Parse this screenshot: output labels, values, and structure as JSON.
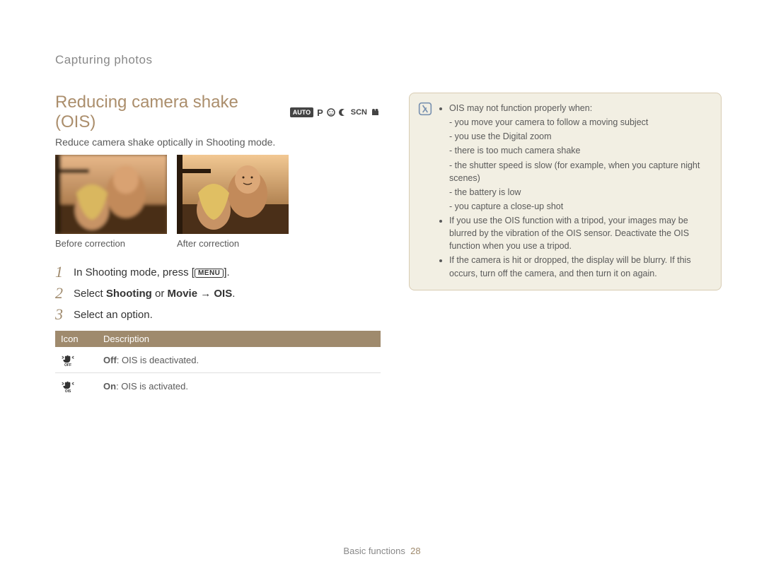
{
  "chapter": "Capturing photos",
  "heading": "Reducing camera shake (OIS)",
  "mode_icons": {
    "auto": "AUTO",
    "p": "P",
    "scn": "SCN"
  },
  "subhead": "Reduce camera shake optically in Shooting mode.",
  "before_caption": "Before correction",
  "after_caption": "After correction",
  "steps": [
    {
      "num": "1",
      "prefix": "In Shooting mode, press [",
      "btn": "MENU",
      "suffix": "]."
    },
    {
      "num": "2",
      "text_a": "Select ",
      "bold_a": "Shooting",
      "text_b": " or ",
      "bold_b": "Movie",
      "text_c": " → ",
      "bold_c": "OIS",
      "text_d": "."
    },
    {
      "num": "3",
      "text": "Select an option."
    }
  ],
  "table": {
    "col_icon": "Icon",
    "col_desc": "Description",
    "rows": [
      {
        "icon": "off",
        "bold": "Off",
        "rest": ": OIS is deactivated."
      },
      {
        "icon": "on",
        "bold": "On",
        "rest": ": OIS is activated."
      }
    ]
  },
  "notebox": {
    "lead": "OIS may not function properly when:",
    "dashes": [
      "you move your camera to follow a moving subject",
      "you use the Digital zoom",
      "there is too much camera shake",
      "the shutter speed is slow (for example, when you capture night scenes)",
      "the battery is low",
      "you capture a close-up shot"
    ],
    "bullet2": "If you use the OIS function with a tripod, your images may be blurred by the vibration of the OIS sensor. Deactivate the OIS function when you use a tripod.",
    "bullet3": "If the camera is hit or dropped, the display will be blurry. If this occurs, turn off the camera, and then turn it on again."
  },
  "footer_label": "Basic functions",
  "footer_page": "28"
}
